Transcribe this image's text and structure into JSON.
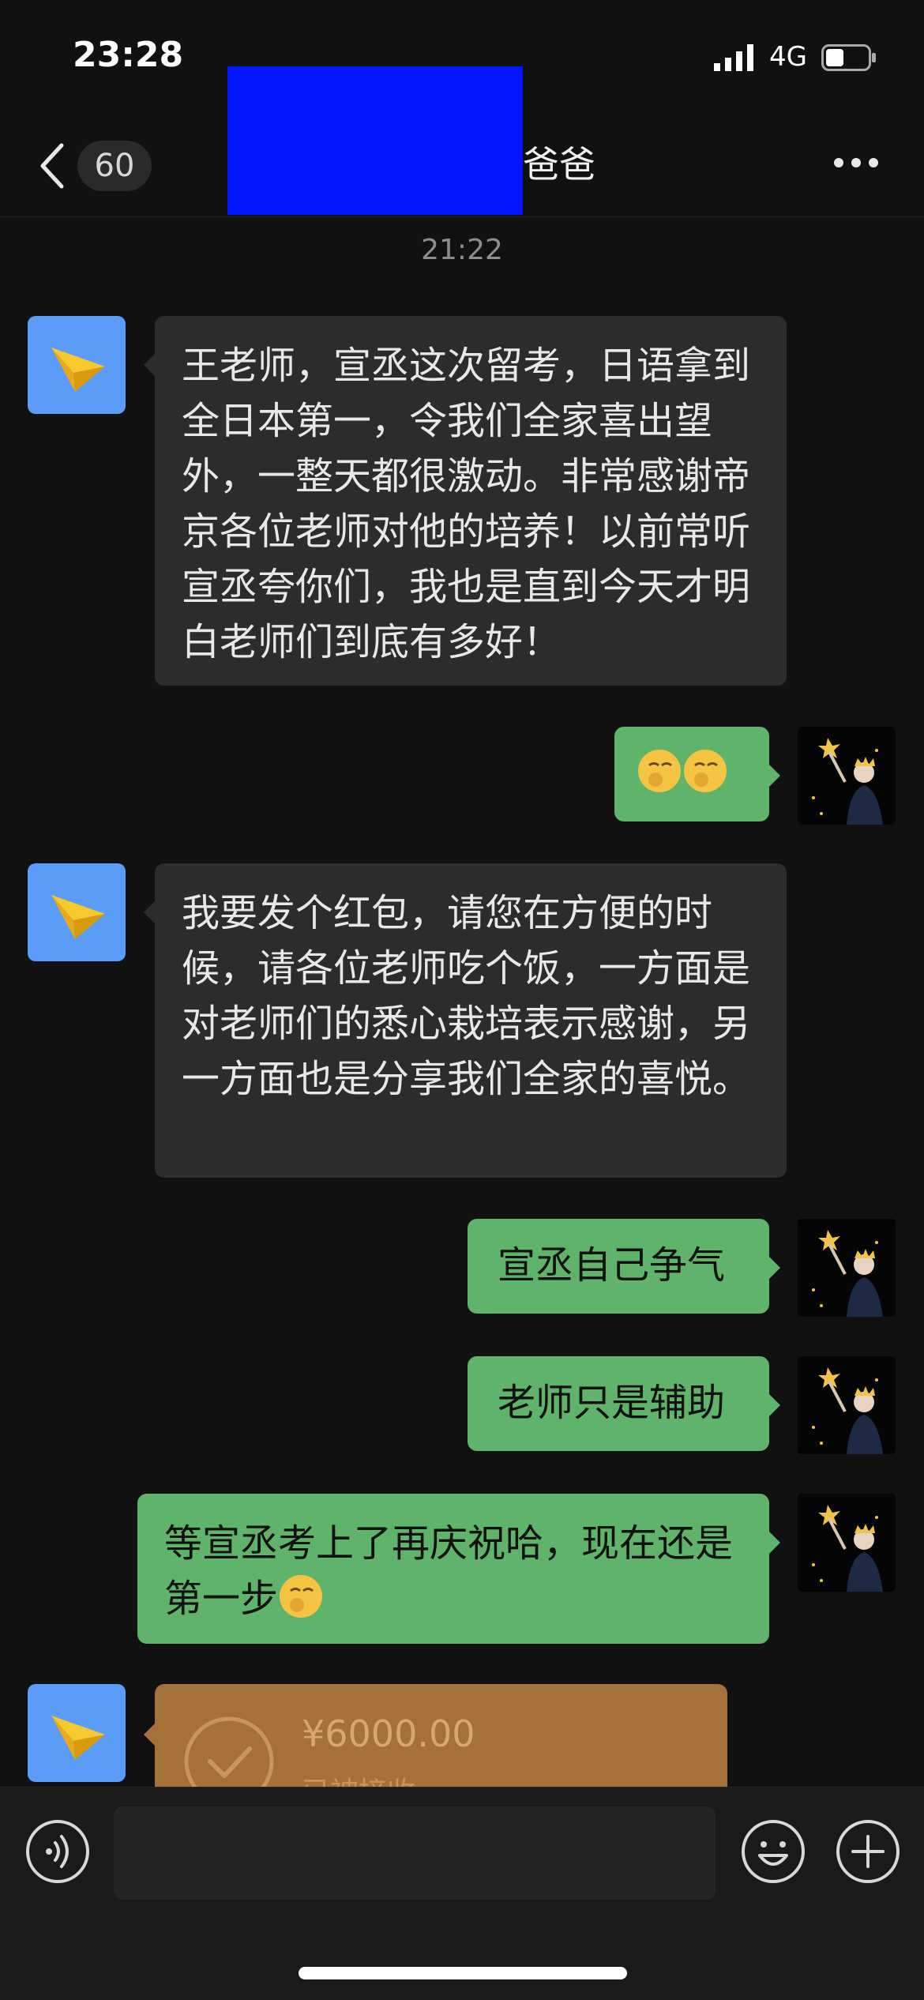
{
  "status_bar": {
    "time": "23:28",
    "network": "4G"
  },
  "nav": {
    "unread_count": "60",
    "title": "爸爸"
  },
  "timestamp": "21:22",
  "messages": [
    {
      "side": "in",
      "text": "王老师，宣丞这次留考，日语拿到全日本第一，令我们全家喜出望外，一整天都很激动。非常感谢帝京各位老师对他的培养！以前常听宣丞夸你们，我也是直到今天才明白老师们到底有多好！"
    },
    {
      "side": "out",
      "emojis": [
        "smirk-face-emoji",
        "smirk-face-emoji"
      ]
    },
    {
      "side": "in",
      "text": "我要发个红包，请您在方便的时候，请各位老师吃个饭，一方面是对老师们的悉心栽培表示感谢，另一方面也是分享我们全家的喜悦。"
    },
    {
      "side": "out",
      "text": "宣丞自己争气"
    },
    {
      "side": "out",
      "text": "老师只是辅助"
    },
    {
      "side": "out",
      "text": "等宣丞考上了再庆祝哈，现在还是第一步",
      "emoji": "smirk-face-emoji"
    }
  ],
  "red_packet": {
    "amount": "¥6000.00",
    "status": "已被接收"
  },
  "input": {
    "placeholder": ""
  },
  "colors": {
    "incoming_bubble": "#2c2c2c",
    "outgoing_bubble": "#5fb36a",
    "avatar_blue": "#5a9cf8",
    "red_packet": "#a5703a"
  }
}
